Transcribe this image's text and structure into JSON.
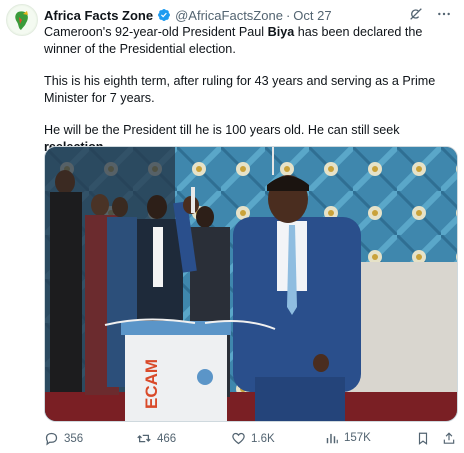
{
  "account": {
    "name": "Africa Facts Zone",
    "handle": "@AfricaFactsZone",
    "separator": "·",
    "date": "Oct 27"
  },
  "tweet": {
    "p1_a": "Cameroon's 92-year-old President Paul ",
    "p1_b": "Biya",
    "p1_c": " has been declared the winner of the Presidential election.",
    "p2": "This is his eighth term, after ruling for 43 years and serving as a Prime Minister for 7 years.",
    "p3_a": "He will be the President till he is 100 years old. He can still seek ",
    "p3_b": "reelection",
    "p3_c": "."
  },
  "media": {
    "ballot_box_text": "ECAM"
  },
  "stats": {
    "replies": "356",
    "reposts": "466",
    "likes": "1.6K",
    "views": "157K"
  },
  "colors": {
    "verified": "#1d9bf0",
    "secondary_text": "#536471",
    "backdrop": "#4c8fb0"
  },
  "icons": [
    "verified-badge-icon",
    "grok-icon",
    "more-icon",
    "reply-icon",
    "repost-icon",
    "like-icon",
    "views-icon",
    "bookmark-icon",
    "share-icon"
  ]
}
